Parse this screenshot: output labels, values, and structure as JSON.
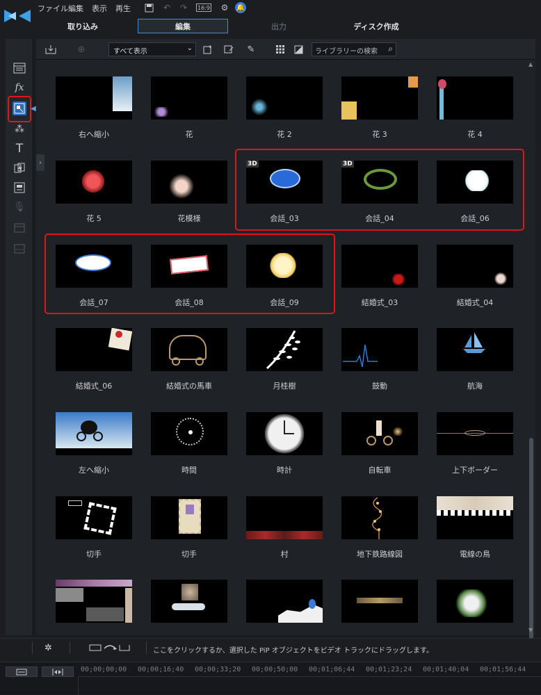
{
  "menu": {
    "file": "ファイル",
    "edit": "編集",
    "view": "表示",
    "play": "再生",
    "aspect": "16:9"
  },
  "tabs": {
    "capture": "取り込み",
    "edit": "編集",
    "output": "出力",
    "disc": "ディスク作成"
  },
  "library": {
    "filter": "すべて表示",
    "search_placeholder": "ライブラリーの検索",
    "items": [
      {
        "label": "右へ縮小"
      },
      {
        "label": "花"
      },
      {
        "label": "花 2"
      },
      {
        "label": "花 3"
      },
      {
        "label": "花 4"
      },
      {
        "label": "花 5"
      },
      {
        "label": "花模様"
      },
      {
        "label": "会話_03",
        "badge": "3D"
      },
      {
        "label": "会話_04",
        "badge": "3D"
      },
      {
        "label": "会話_06"
      },
      {
        "label": "会話_07"
      },
      {
        "label": "会話_08"
      },
      {
        "label": "会話_09"
      },
      {
        "label": "結婚式_03"
      },
      {
        "label": "結婚式_04"
      },
      {
        "label": "結婚式_06"
      },
      {
        "label": "結婚式の馬車"
      },
      {
        "label": "月桂樹"
      },
      {
        "label": "鼓動"
      },
      {
        "label": "航海"
      },
      {
        "label": "左へ縮小"
      },
      {
        "label": "時間"
      },
      {
        "label": "時計"
      },
      {
        "label": "自転車"
      },
      {
        "label": "上下ボーダー"
      },
      {
        "label": "切手"
      },
      {
        "label": "切手"
      },
      {
        "label": "村"
      },
      {
        "label": "地下鉄路線図"
      },
      {
        "label": "電線の鳥"
      },
      {
        "label": ""
      },
      {
        "label": ""
      },
      {
        "label": ""
      },
      {
        "label": ""
      },
      {
        "label": ""
      }
    ]
  },
  "status": {
    "hint": "ここをクリックするか、選択した PiP オブジェクトをビデオ トラックにドラッグします。"
  },
  "timeline": {
    "timecodes": [
      "00;00;00;00",
      "00;00;16;40",
      "00;00;33;20",
      "00;00;50;00",
      "00;01;06;44",
      "00;01;23;24",
      "00;01;40;04",
      "00;01;56;44"
    ]
  },
  "colors": {
    "accent": "#4a8ad0",
    "highlight": "#e0151b"
  }
}
